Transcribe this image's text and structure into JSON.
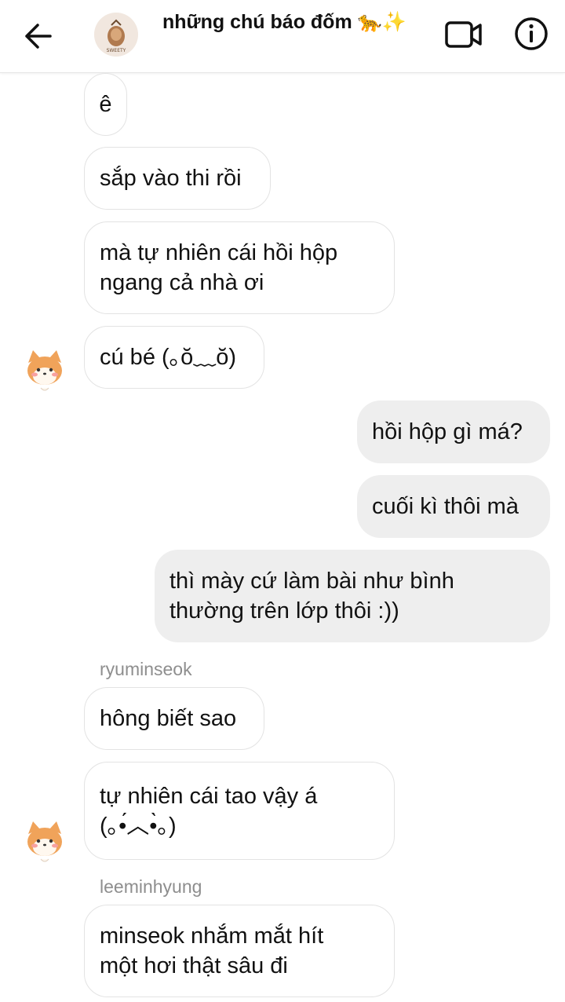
{
  "header": {
    "title": "những chú báo đốm 🐆✨",
    "group_avatar_text": "SWEETY"
  },
  "messages": [
    {
      "text": "ê"
    },
    {
      "text": "sắp vào thi rồi"
    },
    {
      "text": "mà tự nhiên cái hồi hộp\nngang cả nhà ơi"
    },
    {
      "text": "cú bé (｡ŏ﹏ŏ)"
    },
    {
      "text": "hồi hộp gì má?"
    },
    {
      "text": "cuối kì thôi mà"
    },
    {
      "text": "thì mày cứ làm bài như bình\nthường trên lớp thôi :))"
    },
    {
      "sender": "ryuminseok"
    },
    {
      "text": "hông biết sao"
    },
    {
      "text": "tự nhiên cái tao vậy á\n(｡•́︿•̀｡)"
    },
    {
      "sender": "leeminhyung"
    },
    {
      "text": "minseok nhắm mắt hít\nmột hơi thật sâu đi"
    }
  ],
  "colors": {
    "incoming_bubble": "#ffffff",
    "outgoing_bubble": "#eeeeee",
    "sender_name": "#8e8e8e",
    "avatar": "#f0a35a"
  }
}
